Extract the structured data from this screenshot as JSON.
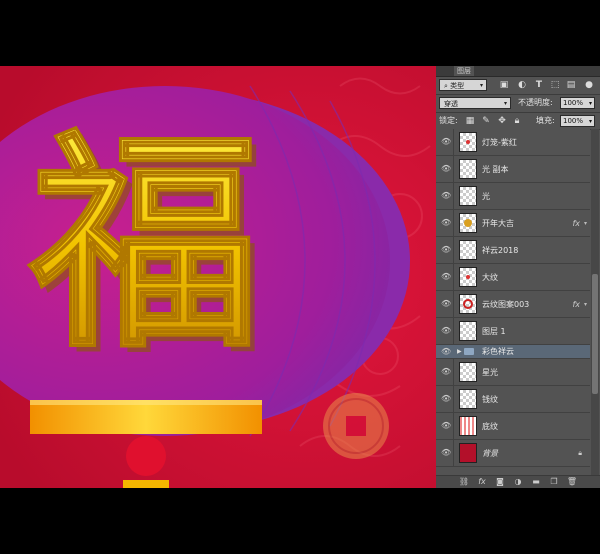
{
  "colors": {
    "canvas_red": "#d8103a",
    "lantern_purple": "#a21f9a",
    "character_gold": "#f5c800",
    "panel_bg": "#535353",
    "selected_row": "#5a6877"
  },
  "canvas": {
    "character": "福"
  },
  "panel": {
    "tab_label": "图层",
    "filter": {
      "value": "类型",
      "icons": [
        "image-filter-icon",
        "adjustment-filter-icon",
        "text-filter-icon",
        "shape-filter-icon",
        "smart-object-filter-icon"
      ]
    },
    "blend_mode": "穿透",
    "opacity_label": "不透明度:",
    "opacity_value": "100%",
    "lock_label": "锁定:",
    "fill_label": "填充:",
    "fill_value": "100%",
    "layers": [
      {
        "name": "灯笼-紫红",
        "thumb": "mark",
        "fx": false
      },
      {
        "name": "光 副本",
        "thumb": "transparent",
        "fx": false
      },
      {
        "name": "光",
        "thumb": "transparent",
        "fx": false
      },
      {
        "name": "开年大吉",
        "thumb": "gold",
        "fx": true
      },
      {
        "name": "祥云2018",
        "thumb": "transparent",
        "fx": false
      },
      {
        "name": "大纹",
        "thumb": "mark",
        "fx": false
      },
      {
        "name": "云纹图案003",
        "thumb": "seal",
        "fx": true
      },
      {
        "name": "图层 1",
        "thumb": "transparent",
        "fx": false
      },
      {
        "name": "彩色祥云",
        "group": true
      },
      {
        "name": "星光",
        "thumb": "transparent",
        "fx": false
      },
      {
        "name": "钱纹",
        "thumb": "transparent",
        "fx": false
      },
      {
        "name": "底纹",
        "thumb": "pattern",
        "fx": false
      },
      {
        "name": "背景",
        "thumb": "red",
        "fx": false,
        "locked": true
      }
    ],
    "fx_label": "fx",
    "bottom_icons": [
      "link-icon",
      "fx-icon",
      "mask-icon",
      "adjustment-icon",
      "group-icon",
      "new-layer-icon",
      "trash-icon"
    ]
  }
}
